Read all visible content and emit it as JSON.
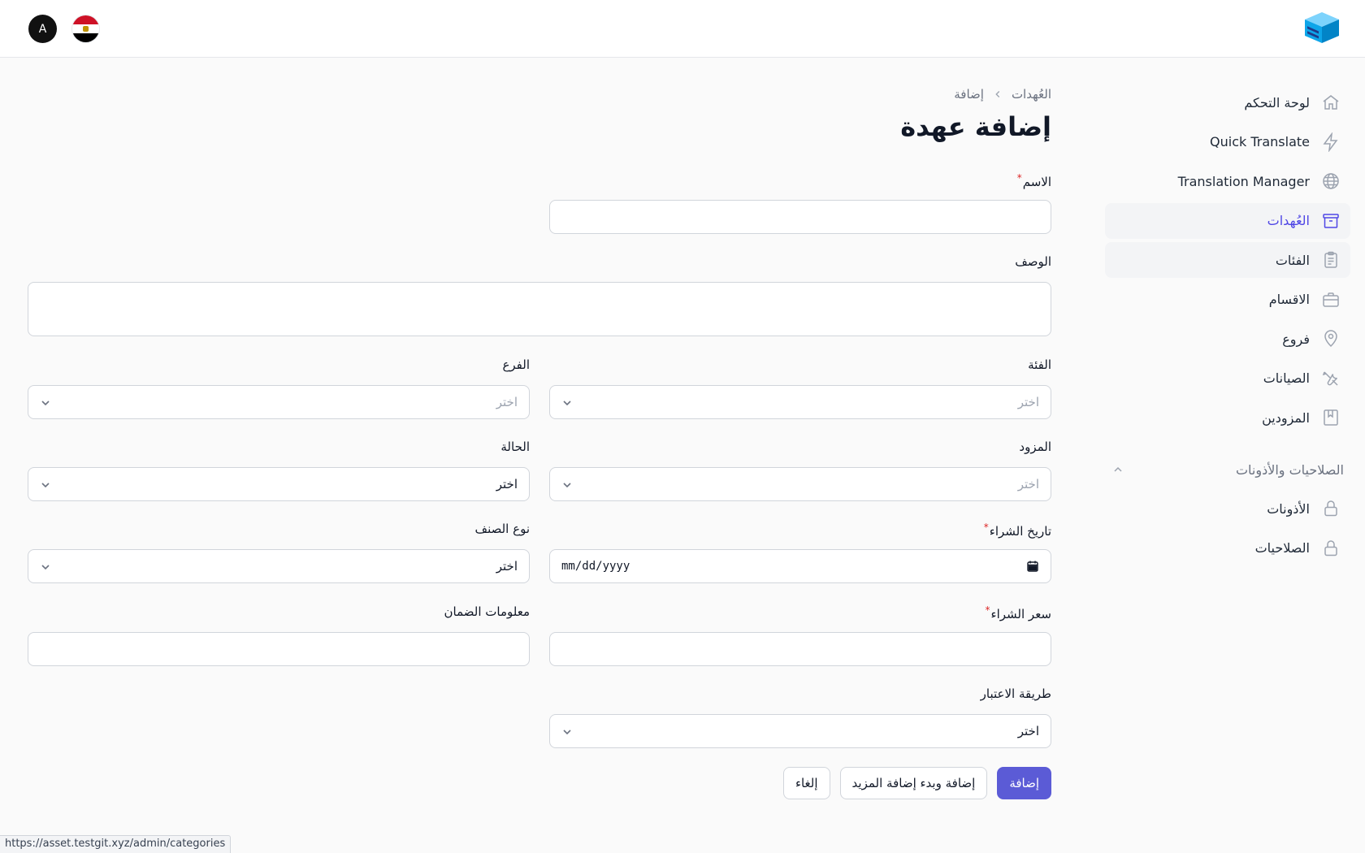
{
  "header": {
    "avatar_letter": "A",
    "flag": "egypt-flag"
  },
  "sidebar": {
    "items": [
      {
        "label": "لوحة التحكم",
        "icon": "home-icon"
      },
      {
        "label": "Quick Translate",
        "icon": "bolt-icon"
      },
      {
        "label": "Translation Manager",
        "icon": "globe-icon"
      },
      {
        "label": "العُهدات",
        "icon": "archive-box-icon",
        "active": true
      },
      {
        "label": "الفئات",
        "icon": "clipboard-icon"
      },
      {
        "label": "الاقسام",
        "icon": "briefcase-icon"
      },
      {
        "label": "فروع",
        "icon": "map-pin-icon"
      },
      {
        "label": "الصيانات",
        "icon": "wrench-screwdriver-icon"
      },
      {
        "label": "المزودين",
        "icon": "book-icon"
      }
    ],
    "group": {
      "label": "الصلاحيات والأذونات",
      "items": [
        {
          "label": "الأذونات",
          "icon": "lock-icon"
        },
        {
          "label": "الصلاحيات",
          "icon": "lock-icon"
        }
      ]
    }
  },
  "breadcrumb": {
    "parent": "العُهدات",
    "current": "إضافة"
  },
  "page": {
    "title": "إضافة عهدة"
  },
  "form": {
    "name": {
      "label": "الاسم",
      "value": ""
    },
    "description": {
      "label": "الوصف",
      "value": ""
    },
    "category": {
      "label": "الفئة",
      "placeholder": "اختر"
    },
    "branch": {
      "label": "الفرع",
      "placeholder": "اختر"
    },
    "supplier": {
      "label": "المزود",
      "placeholder": "اختر"
    },
    "status": {
      "label": "الحالة",
      "value": "اختر"
    },
    "purchase_date": {
      "label": "تاريخ الشراء",
      "placeholder": "mm/dd/yyyy"
    },
    "item_type": {
      "label": "نوع الصنف",
      "value": "اختر"
    },
    "purchase_price": {
      "label": "سعر الشراء",
      "value": ""
    },
    "warranty": {
      "label": "معلومات الضمان",
      "value": ""
    },
    "depreciation": {
      "label": "طريقة الاعتبار",
      "value": "اختر"
    }
  },
  "actions": {
    "create": "إضافة",
    "create_another": "إضافة وبدء إضافة المزيد",
    "cancel": "إلغاء"
  },
  "status_url": "https://asset.testgit.xyz/admin/categories",
  "colors": {
    "primary": "#5b5bd6",
    "active_nav": "#4f46e5",
    "required": "#dc2626"
  }
}
